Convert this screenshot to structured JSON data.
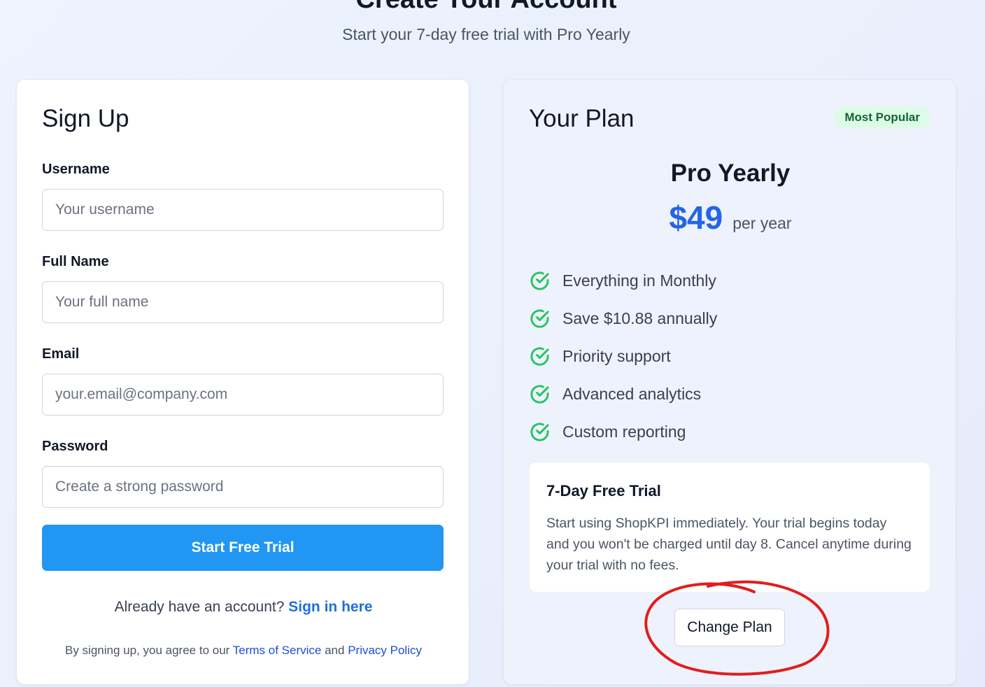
{
  "header": {
    "title": "Create Your Account",
    "subtitle": "Start your 7-day free trial with Pro Yearly"
  },
  "signup": {
    "heading": "Sign Up",
    "fields": [
      {
        "label": "Username",
        "placeholder": "Your username",
        "value": ""
      },
      {
        "label": "Full Name",
        "placeholder": "Your full name",
        "value": ""
      },
      {
        "label": "Email",
        "placeholder": "your.email@company.com",
        "value": ""
      },
      {
        "label": "Password",
        "placeholder": "Create a strong password",
        "value": ""
      }
    ],
    "submit_label": "Start Free Trial",
    "signin_prompt": "Already have an account?",
    "signin_link": "Sign in here",
    "legal": {
      "prefix": "By signing up, you agree to our",
      "terms": "Terms of Service",
      "and": "and",
      "privacy": "Privacy Policy"
    }
  },
  "plan": {
    "heading": "Your Plan",
    "badge": "Most Popular",
    "name": "Pro Yearly",
    "price": "$49",
    "period": "per year",
    "features": [
      "Everything in Monthly",
      "Save $10.88 annually",
      "Priority support",
      "Advanced analytics",
      "Custom reporting"
    ],
    "feature_icon": "check-circle-icon",
    "trial": {
      "title": "7-Day Free Trial",
      "text": "Start using ShopKPI immediately. Your trial begins today and you won't be charged until day 8. Cancel anytime during your trial with no fees."
    },
    "change_label": "Change Plan"
  },
  "colors": {
    "primary_button": "#2196f3",
    "price": "#2563eb",
    "check": "#22c55e",
    "badge_bg": "#dcfce7",
    "badge_text": "#166534",
    "annotation": "#e11d1d"
  }
}
